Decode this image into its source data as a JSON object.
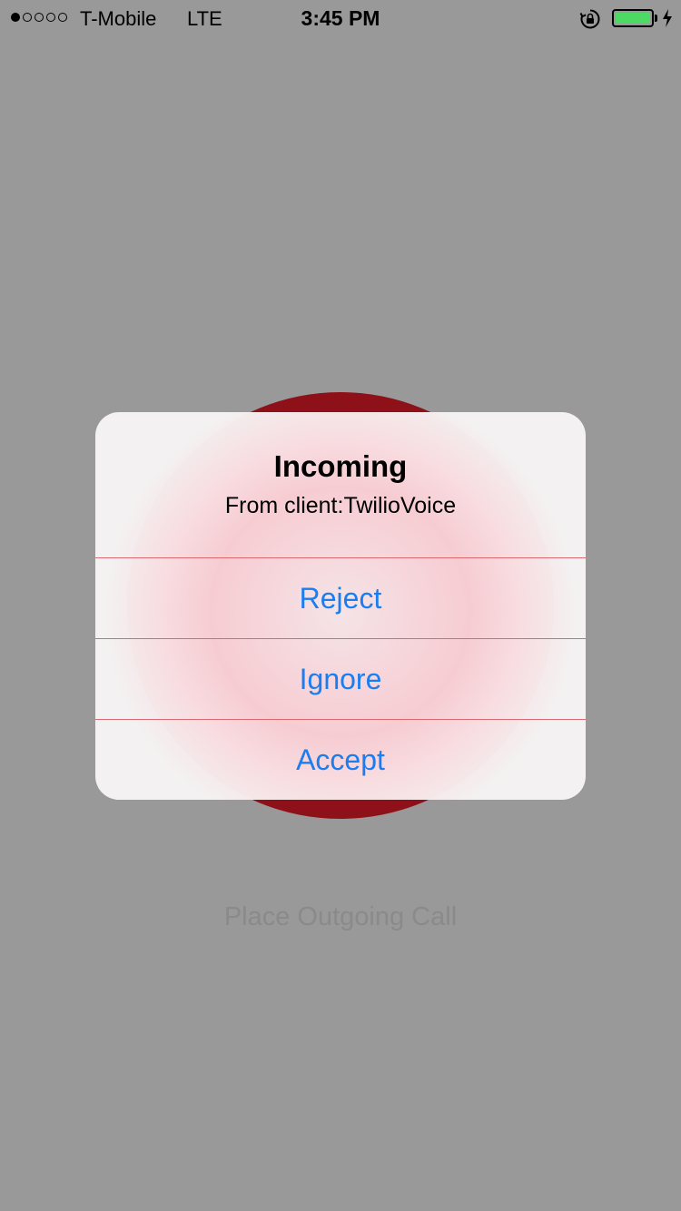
{
  "status_bar": {
    "carrier": "T-Mobile",
    "network": "LTE",
    "time": "3:45 PM",
    "signal_bars_filled": 1,
    "signal_bars_total": 5,
    "battery_level": 1.0,
    "battery_color": "#4cd964",
    "icons": [
      "rotation-lock-icon",
      "battery-icon",
      "charging-bolt-icon"
    ]
  },
  "background": {
    "call_button_color": "#8e1119",
    "outgoing_label": "Place Outgoing Call"
  },
  "alert": {
    "title": "Incoming",
    "message": "From client:TwilioVoice",
    "buttons": [
      {
        "label": "Reject"
      },
      {
        "label": "Ignore"
      },
      {
        "label": "Accept"
      }
    ],
    "button_color": "#1a7ef2"
  }
}
